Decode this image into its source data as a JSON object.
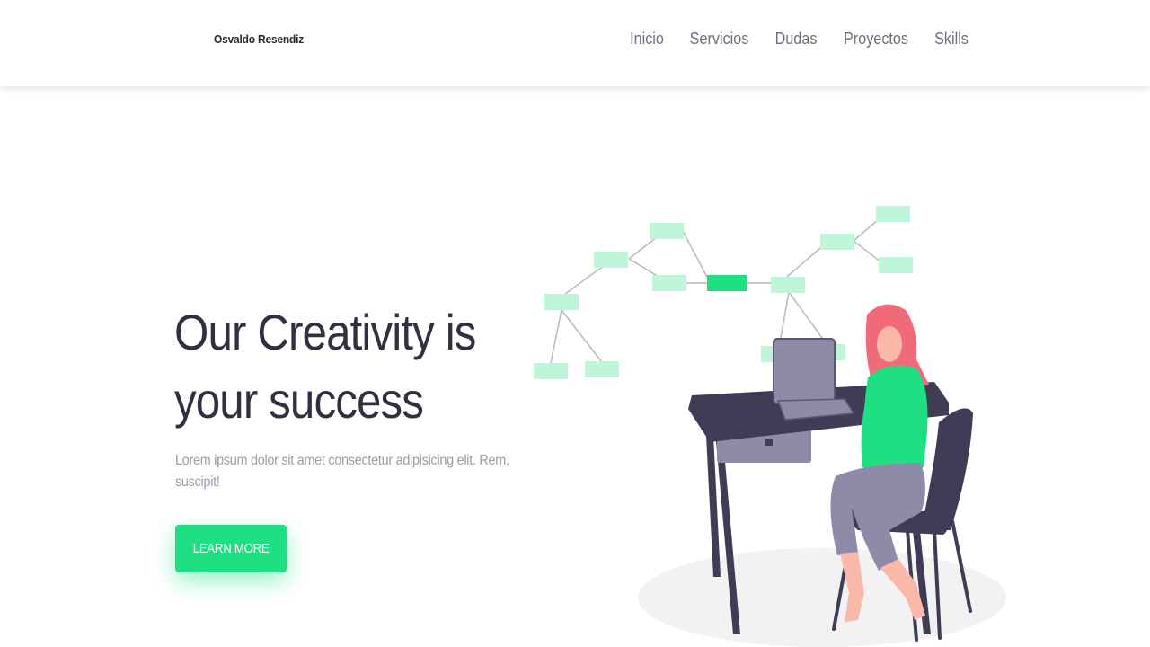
{
  "nav": {
    "brand": "Osvaldo Resendiz",
    "links": [
      "Inicio",
      "Servicios",
      "Dudas",
      "Proyectos",
      "Skills"
    ]
  },
  "hero": {
    "title_line1": "Our Creativity is",
    "title_line2": "your success",
    "text": "Lorem ipsum dolor sit amet consectetur adipisicing elit. Rem, suscipit!",
    "cta": "LEARN MORE"
  },
  "colors": {
    "accent": "#1fdf83",
    "node_light": "#bff5d8",
    "dark": "#3f3d56",
    "laptop": "#8e8ba8",
    "hair": "#f06a7a",
    "skin": "#f8b9a8"
  }
}
